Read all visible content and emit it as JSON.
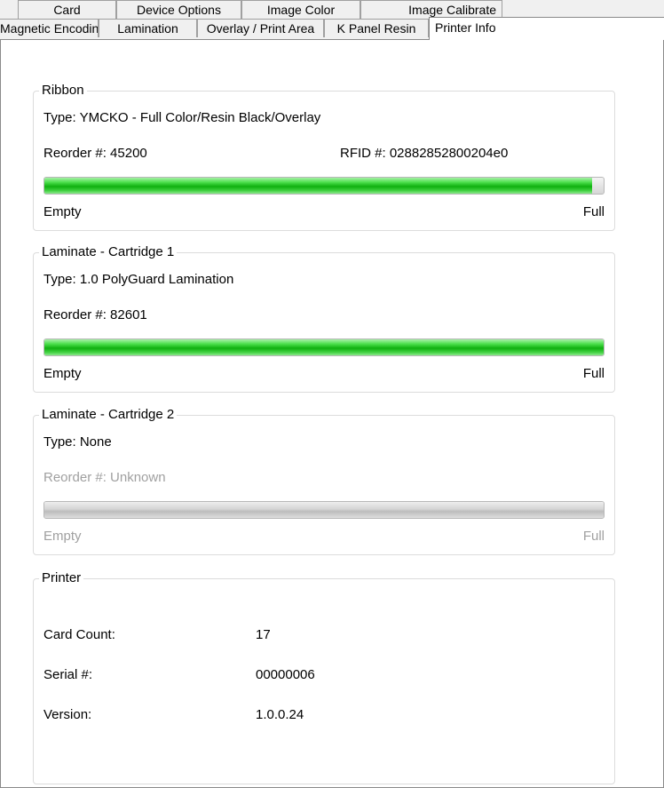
{
  "tabs_row1": [
    "Card",
    "Device Options",
    "Image Color",
    "Image Calibrate"
  ],
  "tabs_row2": [
    "Magnetic Encoding",
    "Lamination",
    "Overlay / Print Area",
    "K Panel Resin",
    "Printer Info"
  ],
  "active_tab": "Printer Info",
  "ribbon": {
    "title": "Ribbon",
    "type": "Type: YMCKO - Full Color/Resin Black/Overlay",
    "reorder": "Reorder #: 45200",
    "rfid": "RFID #: 02882852800204e0",
    "level_percent": 98,
    "empty_label": "Empty",
    "full_label": "Full"
  },
  "laminate1": {
    "title": "Laminate - Cartridge 1",
    "type": "Type: 1.0 PolyGuard Lamination",
    "reorder": "Reorder #: 82601",
    "level_percent": 100,
    "empty_label": "Empty",
    "full_label": "Full"
  },
  "laminate2": {
    "title": "Laminate - Cartridge 2",
    "type": "Type: None",
    "reorder": "Reorder #: Unknown",
    "level_percent": 0,
    "empty_label": "Empty",
    "full_label": "Full"
  },
  "printer": {
    "title": "Printer",
    "card_count_label": "Card Count:",
    "card_count": "17",
    "serial_label": "Serial #:",
    "serial": "00000006",
    "version_label": "Version:",
    "version": "1.0.0.24"
  },
  "colors": {
    "progress_green": "#10b010",
    "disabled_text": "#a0a0a0"
  }
}
